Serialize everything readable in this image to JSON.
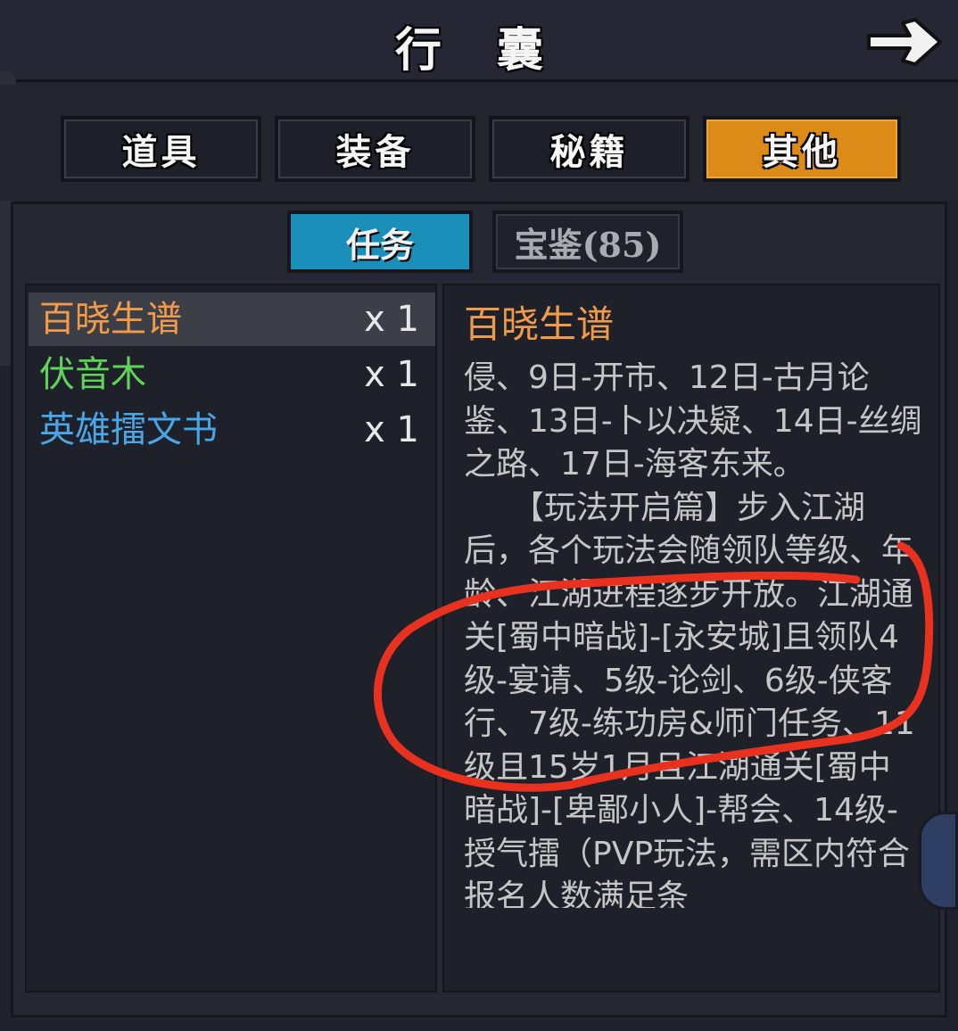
{
  "window": {
    "title": "行 囊"
  },
  "tabs": [
    {
      "label": "道具",
      "active": false
    },
    {
      "label": "装备",
      "active": false
    },
    {
      "label": "秘籍",
      "active": false
    },
    {
      "label": "其他",
      "active": true
    }
  ],
  "subtabs": [
    {
      "label": "任务",
      "active": true
    },
    {
      "label": "宝鉴(85)",
      "active": false
    }
  ],
  "items": [
    {
      "name": "百晓生谱",
      "qty": "x 1",
      "color": "#f09b4a",
      "selected": true
    },
    {
      "name": "伏音木",
      "qty": "x 1",
      "color": "#5fd35a",
      "selected": false
    },
    {
      "name": "英雄擂文书",
      "qty": "x 1",
      "color": "#4aa6e6",
      "selected": false
    }
  ],
  "detail": {
    "title": "百晓生谱",
    "body": "侵、9日-开市、12日-古月论鉴、13日-卜以决疑、14日-丝绸之路、17日-海客东来。\n　　【玩法开启篇】步入江湖后，各个玩法会随领队等级、年龄、江湖进程逐步开放。江湖通关[蜀中暗战]-[永安城]且领队4级-宴请、5级-论剑、6级-侠客行、7级-练功房&师门任务、11级且15岁1月且江湖通关[蜀中暗战]-[卑鄙小人]-帮会、14级-授气擂（PVP玩法，需区内符合报名人数满足条"
  },
  "colors": {
    "accent_tab": "#dc8a18",
    "accent_subtab": "#1a8fba",
    "annotation_circle": "#e8321f"
  },
  "icons": {
    "back": "arrow-right-icon"
  }
}
